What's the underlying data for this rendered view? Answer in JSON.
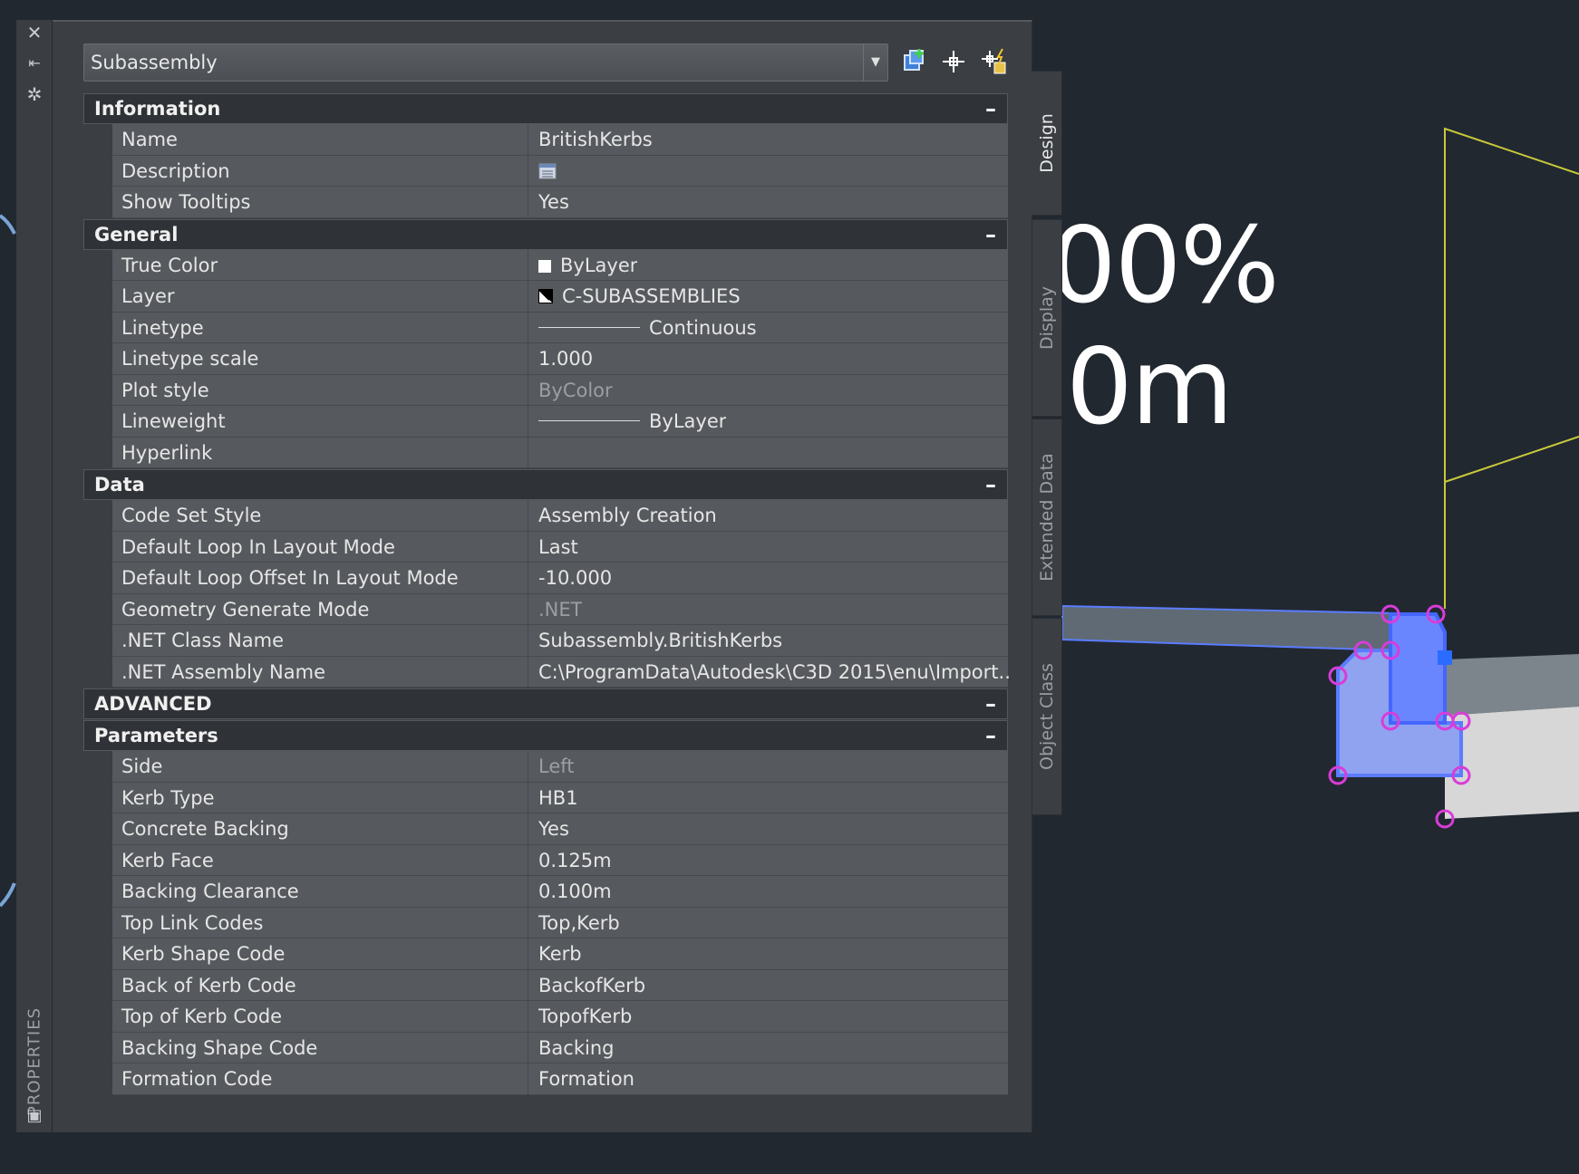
{
  "palette": {
    "title": "PROPERTIES",
    "close_icon": "close-icon",
    "autohide_icon": "autohide-icon",
    "settings_icon": "settings-icon"
  },
  "selector": {
    "value": "Subassembly"
  },
  "toolbar": {
    "icons": [
      "select-objects-icon",
      "quick-select-icon",
      "toggle-pickadd-icon"
    ]
  },
  "tabs": [
    "Design",
    "Display",
    "Extended Data",
    "Object Class"
  ],
  "categories": {
    "information": {
      "title": "Information",
      "toggle": "–",
      "rows": [
        {
          "label": "Name",
          "value": "BritishKerbs"
        },
        {
          "label": "Description",
          "value": ""
        },
        {
          "label": "Show Tooltips",
          "value": "Yes"
        }
      ]
    },
    "general": {
      "title": "General",
      "toggle": "–",
      "rows": [
        {
          "label": "True Color",
          "value": "ByLayer"
        },
        {
          "label": "Layer",
          "value": "C-SUBASSEMBLIES"
        },
        {
          "label": "Linetype",
          "value": "Continuous"
        },
        {
          "label": "Linetype scale",
          "value": "1.000"
        },
        {
          "label": "Plot style",
          "value": "ByColor"
        },
        {
          "label": "Lineweight",
          "value": "ByLayer"
        },
        {
          "label": "Hyperlink",
          "value": ""
        }
      ]
    },
    "data": {
      "title": "Data",
      "toggle": "–",
      "rows": [
        {
          "label": "Code Set Style",
          "value": "Assembly Creation"
        },
        {
          "label": "Default Loop In Layout Mode",
          "value": "Last"
        },
        {
          "label": "Default Loop Offset In Layout Mode",
          "value": "-10.000"
        },
        {
          "label": "Geometry Generate Mode",
          "value": ".NET"
        },
        {
          "label": ".NET Class Name",
          "value": "Subassembly.BritishKerbs"
        },
        {
          "label": ".NET Assembly Name",
          "value": "C:\\ProgramData\\Autodesk\\C3D  2015\\enu\\Import..."
        }
      ]
    },
    "advanced": {
      "title": "ADVANCED",
      "toggle": "–"
    },
    "parameters": {
      "title": "Parameters",
      "toggle": "–",
      "rows": [
        {
          "label": "Side",
          "value": "Left"
        },
        {
          "label": "Kerb Type",
          "value": "HB1"
        },
        {
          "label": "Concrete Backing",
          "value": "Yes"
        },
        {
          "label": "Kerb Face",
          "value": "0.125m"
        },
        {
          "label": "Backing Clearance",
          "value": "0.100m"
        },
        {
          "label": "Top Link Codes",
          "value": "Top,Kerb"
        },
        {
          "label": "Kerb Shape Code",
          "value": "Kerb"
        },
        {
          "label": "Back of Kerb Code",
          "value": "BackofKerb"
        },
        {
          "label": "Top of Kerb Code",
          "value": "TopofKerb"
        },
        {
          "label": "Backing Shape Code",
          "value": "Backing"
        },
        {
          "label": "Formation Code",
          "value": "Formation"
        }
      ]
    }
  },
  "drawing": {
    "text_line1": "00%",
    "text_line2": "0m"
  },
  "colors": {
    "background": "#212830",
    "grip": "#d93cd9",
    "selection": "#5b7cff",
    "guide": "#c9c93a"
  }
}
